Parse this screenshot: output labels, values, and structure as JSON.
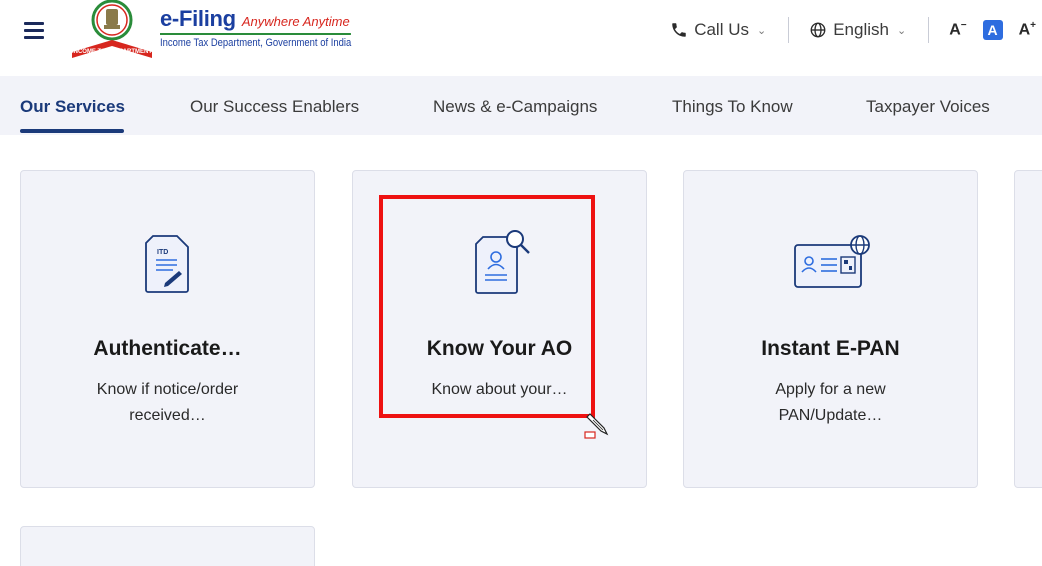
{
  "header": {
    "logo_title": "e-Filing",
    "logo_tagline": "Anywhere Anytime",
    "logo_subtitle": "Income Tax Department, Government of India",
    "emblem_ribbon": "INCOME TAX DEPARTMENT",
    "call_us": "Call Us",
    "language": "English",
    "font_decrease": "A",
    "font_default": "A",
    "font_increase": "A"
  },
  "nav": {
    "tabs": [
      {
        "label": "Our Services"
      },
      {
        "label": "Our Success Enablers"
      },
      {
        "label": "News & e-Campaigns"
      },
      {
        "label": "Things To Know"
      },
      {
        "label": "Taxpayer Voices"
      }
    ],
    "active_tab": "Our Services"
  },
  "cards": [
    {
      "title": "Authenticate…",
      "desc1": "Know if notice/order",
      "desc2": "received…",
      "icon": "itd-document-icon"
    },
    {
      "title": "Know Your AO",
      "desc1": "Know about your…",
      "desc2": "",
      "icon": "document-search-icon"
    },
    {
      "title": "Instant E-PAN",
      "desc1": "Apply for a new",
      "desc2": "PAN/Update…",
      "icon": "pan-card-globe-icon"
    }
  ],
  "colors": {
    "brand_blue": "#1b3a7a",
    "highlight_red": "#ee1111",
    "card_bg": "#f2f3f9"
  }
}
